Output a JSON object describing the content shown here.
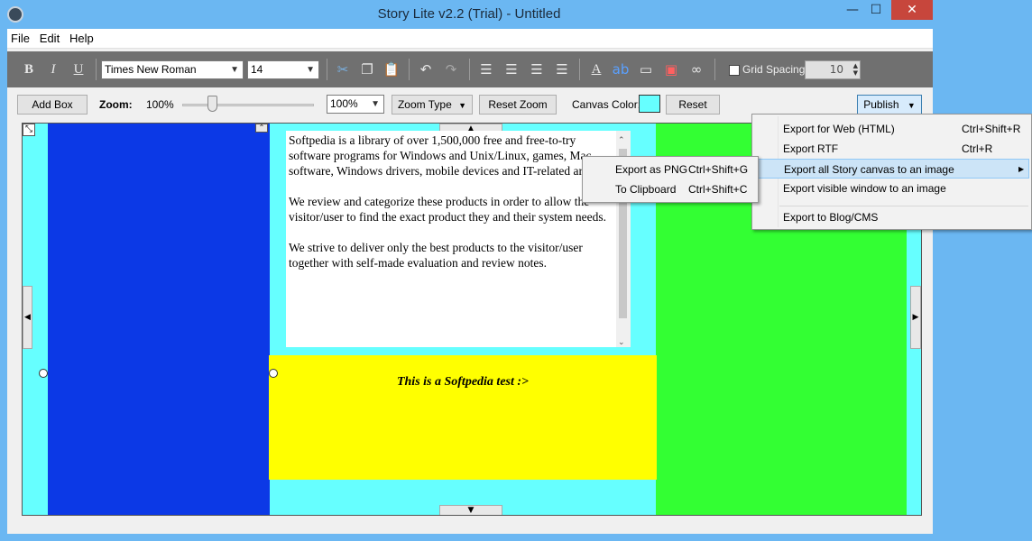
{
  "window": {
    "title": "Story Lite v2.2 (Trial) - Untitled"
  },
  "menubar": {
    "items": [
      "File",
      "Edit",
      "Help"
    ]
  },
  "toolbar": {
    "font_name": "Times New Roman",
    "font_size": "14",
    "grid_spacing_label": "Grid Spacing:",
    "grid_spacing_value": "10",
    "icons": [
      "bold-icon",
      "italic-icon",
      "underline-icon",
      "cut-icon",
      "copy-icon",
      "paste-icon",
      "undo-icon",
      "redo-icon",
      "align-left-icon",
      "align-center-icon",
      "align-right-icon",
      "justify-icon",
      "text-color-icon",
      "highlight-icon",
      "box-fill-icon",
      "box-border-icon",
      "link-icon"
    ]
  },
  "controls": {
    "add_box": "Add Box",
    "zoom_label": "Zoom:",
    "zoom_value": "100%",
    "zoom_combo": "100%",
    "zoom_slider_level": 0.23,
    "zoom_type": "Zoom Type",
    "reset_zoom": "Reset Zoom",
    "canvas_color_label": "Canvas Color:",
    "canvas_color": "#66ffff",
    "reset": "Reset",
    "publish": "Publish"
  },
  "canvas": {
    "text_paragraphs": [
      "Softpedia is a library of over 1,500,000 free and free-to-try software programs for Windows and Unix/Linux, games, Mac software, Windows drivers, mobile devices and IT-related articles.",
      "We review and categorize these products in order to allow the visitor/user to find the exact product they and their system needs.",
      "We strive to deliver only the best products to the visitor/user together with self-made evaluation and review notes."
    ],
    "yellow_text": "This is a Softpedia test :>",
    "colors": {
      "blue": "#0c39e6",
      "green": "#33ff33",
      "yellow": "#ffff00",
      "cyan": "#66ffff"
    }
  },
  "publish_menu": {
    "items": [
      {
        "label": "Export for Web (HTML)",
        "shortcut": "Ctrl+Shift+R"
      },
      {
        "label": "Export RTF",
        "shortcut": "Ctrl+R"
      },
      {
        "label": "Export all Story canvas to an image",
        "shortcut": ""
      },
      {
        "label": "Export visible window to an image",
        "shortcut": ""
      },
      {
        "label": "Export to Blog/CMS",
        "shortcut": ""
      }
    ]
  },
  "export_submenu": {
    "items": [
      {
        "label": "Export as PNG",
        "shortcut": "Ctrl+Shift+G"
      },
      {
        "label": "To Clipboard",
        "shortcut": "Ctrl+Shift+C"
      }
    ]
  }
}
